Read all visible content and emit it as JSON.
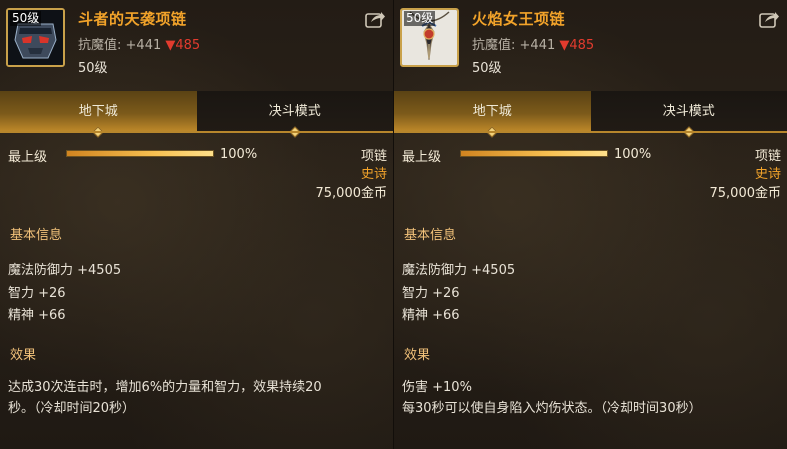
{
  "items": [
    {
      "level_badge": "50级",
      "name": "斗者的天袭项链",
      "resist_label": "抗魔值:",
      "resist_value": "+441",
      "resist_drop": "▼485",
      "level_text": "50级",
      "tabs": [
        "地下城",
        "决斗模式"
      ],
      "grade_label": "最上级",
      "grade_percent": "100%",
      "grade_fill": 1.0,
      "type": "项链",
      "rarity": "史诗",
      "price": "75,000金币",
      "basic_title": "基本信息",
      "stats": [
        "魔法防御力 +4505",
        "智力 +26",
        "精神 +66"
      ],
      "effect_title": "效果",
      "effects": [
        "达成30次连击时，增加6%的力量和智力，效果持续20",
        "秒。（冷却时间20秒）"
      ]
    },
    {
      "level_badge": "50级",
      "name": "火焰女王项链",
      "resist_label": "抗魔值:",
      "resist_value": "+441",
      "resist_drop": "▼485",
      "level_text": "50级",
      "tabs": [
        "地下城",
        "决斗模式"
      ],
      "grade_label": "最上级",
      "grade_percent": "100%",
      "grade_fill": 1.0,
      "type": "项链",
      "rarity": "史诗",
      "price": "75,000金币",
      "basic_title": "基本信息",
      "stats": [
        "魔法防御力 +4505",
        "智力 +26",
        "精神 +66"
      ],
      "effect_title": "效果",
      "effects": [
        "伤害 +10%",
        "每30秒可以使自身陷入灼伤状态。（冷却时间30秒）"
      ]
    }
  ],
  "colors": {
    "item_name": "#f2a32a",
    "resist_drop": "#e23b2e",
    "rarity": "#f2a32a",
    "tab_active": "#c08a2a"
  },
  "icons": {
    "item0": "mask-necklace-icon",
    "item1": "flame-pendant-necklace-icon",
    "share": "share-icon"
  }
}
